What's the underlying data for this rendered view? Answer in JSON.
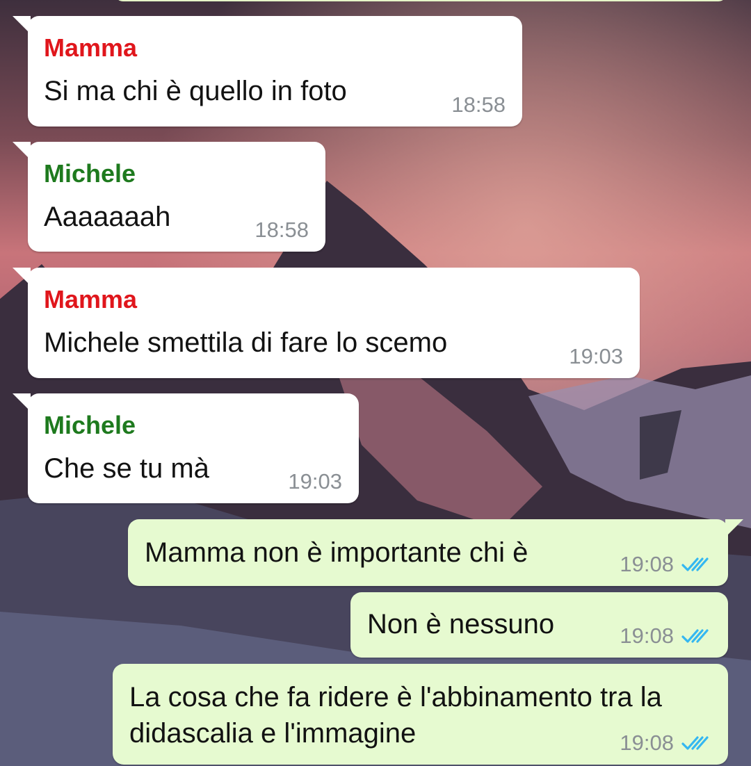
{
  "messages": [
    {
      "sender": "Mamma",
      "text": "Si ma chi è quello in foto",
      "time": "18:58"
    },
    {
      "sender": "Michele",
      "text": "Aaaaaaah",
      "time": "18:58"
    },
    {
      "sender": "Mamma",
      "text": "Michele smettila di fare lo scemo",
      "time": "19:03"
    },
    {
      "sender": "Michele",
      "text": "Che se tu mà",
      "time": "19:03"
    },
    {
      "text": "Mamma non è importante chi è",
      "time": "19:08",
      "status": "read"
    },
    {
      "text": "Non è nessuno",
      "time": "19:08",
      "status": "read"
    },
    {
      "text_lines": [
        "La cosa che fa ridere è l'abbinamento tra la",
        "didascalia e l'immagine"
      ],
      "time": "19:08",
      "status": "read"
    }
  ],
  "colors": {
    "incoming_bubble": "#ffffff",
    "outgoing_bubble": "#e6fad0",
    "sender_mamma": "#e0161c",
    "sender_michele": "#1e7a1e",
    "timestamp": "#8a8f94",
    "read_ticks": "#34b7f1"
  },
  "icons": {
    "read_status": "double-check-icon"
  }
}
